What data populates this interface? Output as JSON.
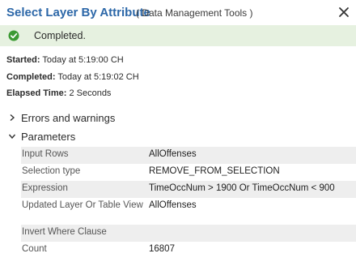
{
  "header": {
    "title": "Select Layer By Attribute",
    "subtitle": "( Data Management Tools )",
    "close_icon": "close-icon"
  },
  "status": {
    "icon": "check-circle-icon",
    "text": "Completed.",
    "color": "#3c9a33"
  },
  "meta": {
    "started_label": "Started:",
    "started_value": "Today at 5:19:00 CH",
    "completed_label": "Completed:",
    "completed_value": "Today at 5:19:02 CH",
    "elapsed_label": "Elapsed Time:",
    "elapsed_value": "2 Seconds"
  },
  "sections": {
    "errors_label": "Errors and warnings",
    "parameters_label": "Parameters"
  },
  "parameters": [
    {
      "name": "Input Rows",
      "value": "AllOffenses"
    },
    {
      "name": "Selection type",
      "value": "REMOVE_FROM_SELECTION"
    },
    {
      "name": "Expression",
      "value": "TimeOccNum > 1900 Or TimeOccNum < 900"
    },
    {
      "name": "Updated Layer Or Table View",
      "value": "AllOffenses"
    },
    {
      "name": "Invert Where Clause",
      "value": ""
    },
    {
      "name": "Count",
      "value": "16807"
    }
  ]
}
